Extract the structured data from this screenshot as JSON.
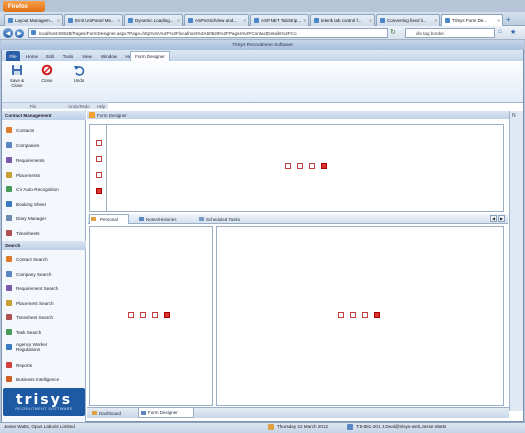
{
  "browser": {
    "menu_button": "Firefox",
    "tabs": [
      {
        "label": "Layout Managem...",
        "active": false
      },
      {
        "label": "Emit UniPanel Me...",
        "active": false
      },
      {
        "label": "Dynamic Loading...",
        "active": false
      },
      {
        "label": "ASPxGridView and...",
        "active": false
      },
      {
        "label": "ASP.NET TabStrip...",
        "active": false
      },
      {
        "label": "telerik tab control f...",
        "active": false
      },
      {
        "label": "Converting fixed li...",
        "active": false
      },
      {
        "label": "TriSys Form De...",
        "active": true
      }
    ],
    "url": "localhost:60628/Pages/FormDesigner.aspx?Page=http%3A%2F%2Flocalhost%3A60628%2FPages%2FContactDetails%2FCo",
    "search_value": "div tag border"
  },
  "app": {
    "title": "TriSys Recruitment Software",
    "menus": [
      "File",
      "Home",
      "Edit",
      "Tools",
      "View",
      "Window",
      "Help",
      "Form Designer"
    ],
    "ribbon": {
      "save_close": "Save & Close",
      "close": "Close",
      "undo": "Undo",
      "groups": [
        "File",
        "Undo/Redo",
        "Help"
      ]
    },
    "sidebar": {
      "contact_heading": "Contact Management",
      "contact_items": [
        "Contacts",
        "Companies",
        "Requirements",
        "Placements",
        "CV Auto-Recognition",
        "Booking Sheet",
        "Diary Manager",
        "Timesheets"
      ],
      "search_heading": "Search",
      "search_items": [
        "Contact Search",
        "Company Search",
        "Requirement Search",
        "Placement Search",
        "Timesheet Search",
        "Task Search",
        "Agency Worker Regulations",
        "Reports",
        "Business Intelligence"
      ],
      "logo_text": "trisys",
      "logo_sub": "RECRUITMENT SOFTWARE"
    },
    "form_designer_heading": "Form Designer",
    "content_tabs": [
      "Personal",
      "Notes/Histories",
      "Scheduled Tasks"
    ],
    "bottom_tabs": [
      "Dashboard",
      "Form Designer"
    ],
    "status": {
      "user": "Jesse Watts, Opus Laboris Limited",
      "date": "Thursday 22 March 2012",
      "contact": "T:5-881-201 J.Deal@trisys-web.Jesse.Watts"
    }
  }
}
